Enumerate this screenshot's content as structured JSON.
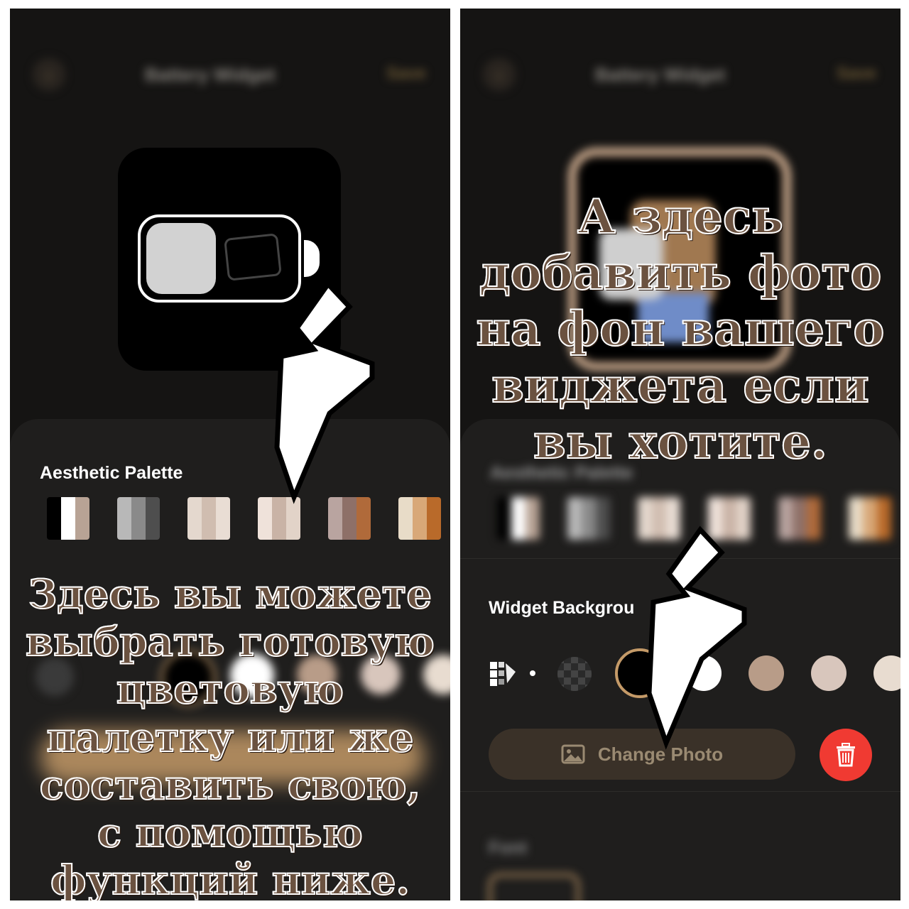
{
  "left": {
    "topbar": {
      "back": "‹",
      "title": "Battery Widget",
      "save": "Save"
    },
    "palette_label": "Aesthetic Palette",
    "palettes": [
      [
        "#000000",
        "#ffffff",
        "#b8a395"
      ],
      [
        "#b8b8b8",
        "#8a8a8a",
        "#4e4e4e"
      ],
      [
        "#e4d8ce",
        "#d0bdb0",
        "#e9ddd4"
      ],
      [
        "#efe2da",
        "#c9b3a6",
        "#e2d3c8"
      ],
      [
        "#b9a4a0",
        "#8e7068",
        "#b06a3a"
      ],
      [
        "#e8dcc8",
        "#d8a878",
        "#b96a2a"
      ]
    ],
    "caption": "Здесь вы можете выбрать готовую цветовую палетку или же составить свою, с помощью функций ниже."
  },
  "right": {
    "topbar": {
      "back": "‹",
      "title": "Battery Widget",
      "save": "Save"
    },
    "palette_label": "Aesthetic Palette",
    "background_label": "Widget Backgrou",
    "background_colors": [
      "#000000",
      "#ffffff",
      "#b89c88",
      "#d8c6bc",
      "#e8dcd0"
    ],
    "change_photo_label": "Change Photo",
    "font_label": "Font",
    "caption": "А здесь добавить фото на фон вашего виджета если вы хотите."
  },
  "colors": {
    "panel_bg": "#151413",
    "sheet_bg": "#1f1e1d",
    "accent_gold": "#c49a68",
    "delete_red": "#f03a32"
  },
  "icons": [
    "back-chevron-icon",
    "battery-icon",
    "photo-icon",
    "cursor-arrow-icon",
    "image-icon",
    "trash-icon",
    "gradient-icon",
    "transparent-checker-icon"
  ]
}
